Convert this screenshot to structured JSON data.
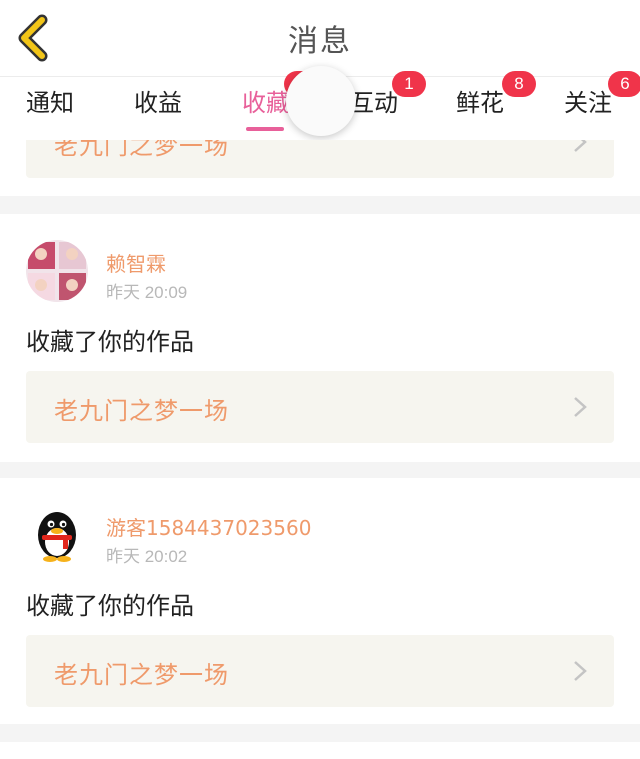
{
  "header": {
    "title": "消息"
  },
  "tabs": [
    {
      "label": "通知",
      "badge": null
    },
    {
      "label": "收益",
      "badge": null
    },
    {
      "label": "收藏",
      "badge": "",
      "active": true
    },
    {
      "label": "互动",
      "badge": "1"
    },
    {
      "label": "鲜花",
      "badge": "8"
    },
    {
      "label": "关注",
      "badge": "6"
    }
  ],
  "notifications": [
    {
      "work_title": "老九门之梦一场"
    },
    {
      "user": "赖智霖",
      "time": "昨天 20:09",
      "action": "收藏了你的作品",
      "work_title": "老九门之梦一场"
    },
    {
      "user": "游客1584437023560",
      "time": "昨天 20:02",
      "action": "收藏了你的作品",
      "work_title": "老九门之梦一场"
    }
  ],
  "colors": {
    "accent": "#e8609a",
    "badge": "#f0344a",
    "work_title": "#ef9a6b",
    "back_icon": "#f2c518"
  }
}
